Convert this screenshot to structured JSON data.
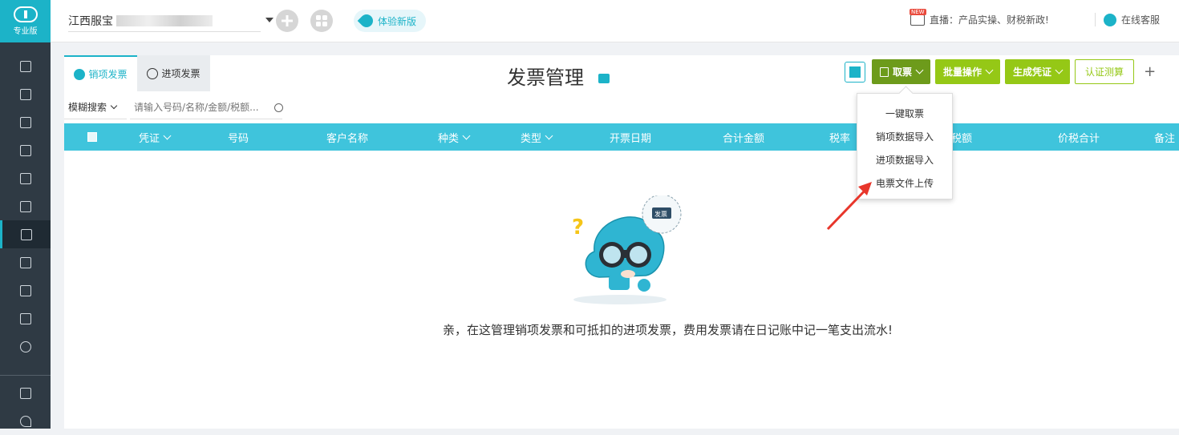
{
  "sidebar": {
    "logo_label": "专业版",
    "items": [
      "vouchers",
      "ledger",
      "reports",
      "assets",
      "calendar",
      "books",
      "invoices",
      "statements",
      "tax",
      "cashier",
      "settings"
    ],
    "bottom_items": [
      "video",
      "help"
    ]
  },
  "topbar": {
    "company_name": "江西服宝",
    "try_new_label": "体验新版",
    "new_badge": "NEW",
    "live_text": "直播：产品实操、财税新政!",
    "service_text": "在线客服"
  },
  "tabs": [
    {
      "label": "销项发票",
      "active": true
    },
    {
      "label": "进项发票",
      "active": false
    }
  ],
  "page_title": "发票管理",
  "toolbar": {
    "fetch_label": "取票",
    "batch_label": "批量操作",
    "voucher_label": "生成凭证",
    "verify_label": "认证测算",
    "plus_label": "+"
  },
  "search": {
    "mode_label": "模糊搜索",
    "placeholder": "请输入号码/名称/金额/税额..."
  },
  "table": {
    "columns": [
      "凭证",
      "号码",
      "客户名称",
      "种类",
      "类型",
      "开票日期",
      "合计金额",
      "税率",
      "税额",
      "价税合计",
      "备注"
    ]
  },
  "dropdown_menu": {
    "items": [
      "一键取票",
      "销项数据导入",
      "进项数据导入",
      "电票文件上传"
    ]
  },
  "empty_state": {
    "badge_label": "发票",
    "message": "亲，在这管理销项发票和可抵扣的进项发票，费用发票请在日记账中记一笔支出流水!"
  },
  "colors": {
    "accent": "#1cb3c8",
    "table_header": "#3fc4dc",
    "green_dark": "#6d9b1b",
    "green_light": "#95c816",
    "sidebar": "#2f3a44",
    "annotation_arrow": "#e8362b"
  }
}
